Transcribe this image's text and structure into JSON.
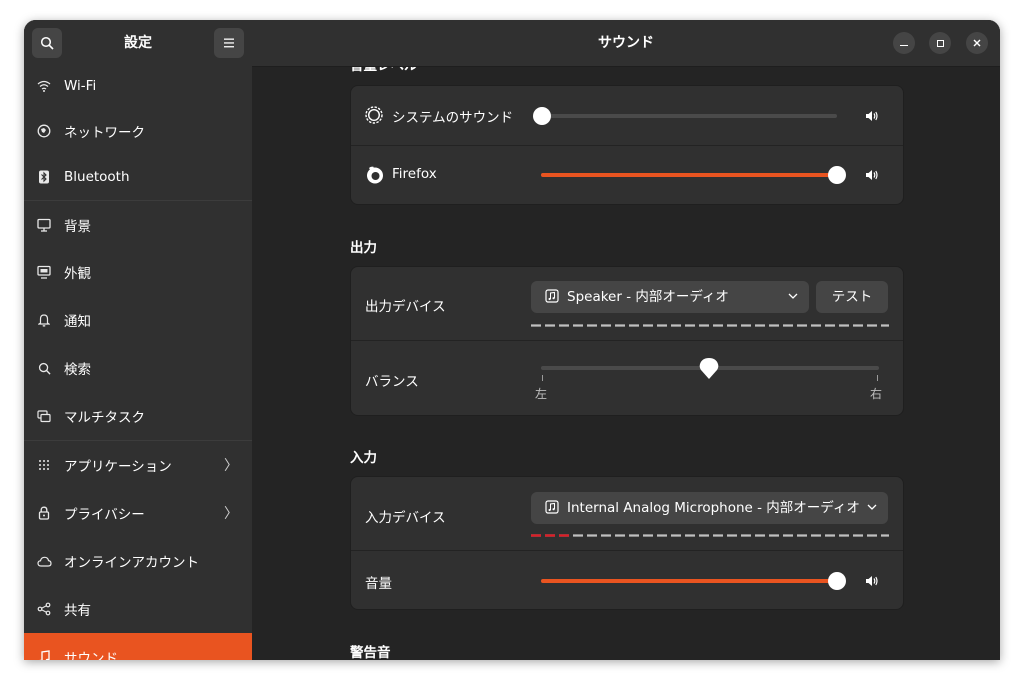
{
  "sidebar": {
    "title": "設定",
    "items": [
      {
        "label": "Wi-Fi",
        "icon": "wifi-icon"
      },
      {
        "label": "ネットワーク",
        "icon": "network-icon"
      },
      {
        "label": "Bluetooth",
        "icon": "bluetooth-icon"
      },
      {
        "label": "背景",
        "icon": "background-icon"
      },
      {
        "label": "外観",
        "icon": "appearance-icon"
      },
      {
        "label": "通知",
        "icon": "bell-icon"
      },
      {
        "label": "検索",
        "icon": "search-icon"
      },
      {
        "label": "マルチタスク",
        "icon": "multitasking-icon"
      },
      {
        "label": "アプリケーション",
        "icon": "apps-grid-icon"
      },
      {
        "label": "プライバシー",
        "icon": "lock-icon"
      },
      {
        "label": "オンラインアカウント",
        "icon": "cloud-icon"
      },
      {
        "label": "共有",
        "icon": "share-icon"
      },
      {
        "label": "サウンド",
        "icon": "music-note-icon"
      }
    ]
  },
  "header": {
    "title": "サウンド"
  },
  "volume_levels": {
    "title": "音量レベル",
    "rows": [
      {
        "label": "システムのサウンド",
        "value": 0
      },
      {
        "label": "Firefox",
        "value": 1.0
      }
    ]
  },
  "output": {
    "title": "出力",
    "device_label": "出力デバイス",
    "device_value": "Speaker - 内部オーディオ",
    "test_label": "テスト",
    "balance_label": "バランス",
    "balance_value": 0.5,
    "left_label": "左",
    "right_label": "右"
  },
  "input": {
    "title": "入力",
    "device_label": "入力デバイス",
    "device_value": "Internal Analog Microphone - 内部オーディオ",
    "volume_label": "音量",
    "volume_value": 1.0,
    "input_level_active_segments": 3
  },
  "alerts": {
    "title": "警告音"
  },
  "colors": {
    "accent": "#e95420",
    "level_active": "#e01b24",
    "level_idle": "#c0c0c0"
  }
}
